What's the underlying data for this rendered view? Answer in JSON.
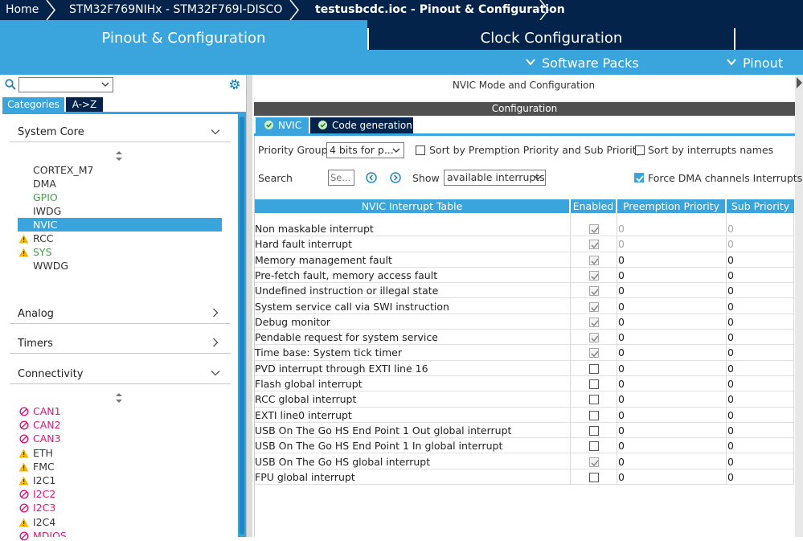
{
  "breadcrumb": {
    "items": [
      "Home",
      "STM32F769NIHx  -  STM32F769I-DISCO",
      "testusbcdc.ioc - Pinout & Configuration"
    ]
  },
  "main_tabs": {
    "pinout": "Pinout & Configuration",
    "clock": "Clock Configuration"
  },
  "subbar": {
    "software_packs": "Software Packs",
    "pinout": "Pinout"
  },
  "left": {
    "category_value": "",
    "tabs": {
      "categories": "Categories",
      "atoz": "A->Z"
    },
    "sections": {
      "system_core": "System Core",
      "analog": "Analog",
      "timers": "Timers",
      "connectivity": "Connectivity"
    },
    "system_core_items": [
      "CORTEX_M7",
      "DMA",
      "GPIO",
      "IWDG",
      "NVIC",
      "RCC",
      "SYS",
      "WWDG"
    ],
    "connectivity_items": [
      "CAN1",
      "CAN2",
      "CAN3",
      "ETH",
      "FMC",
      "I2C1",
      "I2C2",
      "I2C3",
      "I2C4",
      "MDIOS"
    ]
  },
  "right": {
    "title": "NVIC Mode and Configuration",
    "config_label": "Configuration",
    "tabs": {
      "nvic": "NVIC",
      "codegen": "Code generation"
    },
    "priority_group_label": "Priority Group",
    "priority_group_value": "4 bits for p...",
    "sort_premption_label": "Sort by Premption Priority and Sub Priority",
    "sort_names_label": "Sort by interrupts names",
    "search_label": "Search",
    "search_placeholder": "Se...",
    "show_label": "Show",
    "show_value": "available interrupts",
    "force_dma_label": "Force DMA channels Interrupts",
    "sort_premption_checked": false,
    "sort_names_checked": false,
    "force_dma_checked": true
  },
  "table": {
    "headers": [
      "NVIC Interrupt Table",
      "Enabled",
      "Preemption Priority",
      "Sub Priority"
    ],
    "rows": [
      {
        "name": "Non maskable interrupt",
        "enabled": true,
        "locked": true,
        "pre": "0",
        "sub": "0",
        "greyed": true
      },
      {
        "name": "Hard fault interrupt",
        "enabled": true,
        "locked": true,
        "pre": "0",
        "sub": "0",
        "greyed": true
      },
      {
        "name": "Memory management fault",
        "enabled": true,
        "locked": true,
        "pre": "0",
        "sub": "0",
        "greyed": false
      },
      {
        "name": "Pre-fetch fault, memory access fault",
        "enabled": true,
        "locked": true,
        "pre": "0",
        "sub": "0",
        "greyed": false
      },
      {
        "name": "Undefined instruction or illegal state",
        "enabled": true,
        "locked": true,
        "pre": "0",
        "sub": "0",
        "greyed": false
      },
      {
        "name": "System service call via SWI instruction",
        "enabled": true,
        "locked": true,
        "pre": "0",
        "sub": "0",
        "greyed": false
      },
      {
        "name": "Debug monitor",
        "enabled": true,
        "locked": true,
        "pre": "0",
        "sub": "0",
        "greyed": false
      },
      {
        "name": "Pendable request for system service",
        "enabled": true,
        "locked": true,
        "pre": "0",
        "sub": "0",
        "greyed": false
      },
      {
        "name": "Time base: System tick timer",
        "enabled": true,
        "locked": true,
        "pre": "0",
        "sub": "0",
        "greyed": false
      },
      {
        "name": "PVD interrupt through EXTI line 16",
        "enabled": false,
        "locked": false,
        "pre": "0",
        "sub": "0",
        "greyed": false
      },
      {
        "name": "Flash global interrupt",
        "enabled": false,
        "locked": false,
        "pre": "0",
        "sub": "0",
        "greyed": false
      },
      {
        "name": "RCC global interrupt",
        "enabled": false,
        "locked": false,
        "pre": "0",
        "sub": "0",
        "greyed": false
      },
      {
        "name": "EXTI line0 interrupt",
        "enabled": false,
        "locked": false,
        "pre": "0",
        "sub": "0",
        "greyed": false
      },
      {
        "name": "USB On The Go HS End Point 1 Out global interrupt",
        "enabled": false,
        "locked": false,
        "pre": "0",
        "sub": "0",
        "greyed": false
      },
      {
        "name": "USB On The Go HS End Point 1 In global interrupt",
        "enabled": false,
        "locked": false,
        "pre": "0",
        "sub": "0",
        "greyed": false
      },
      {
        "name": "USB On The Go HS global interrupt",
        "enabled": true,
        "locked": true,
        "pre": "0",
        "sub": "0",
        "greyed": false
      },
      {
        "name": "FPU global interrupt",
        "enabled": false,
        "locked": false,
        "pre": "0",
        "sub": "0",
        "greyed": false
      }
    ]
  },
  "colors": {
    "navy": "#03234b",
    "accent": "#3aa5dc",
    "warning": "#f5b800",
    "error": "#e0147e",
    "ok": "#43a047"
  }
}
